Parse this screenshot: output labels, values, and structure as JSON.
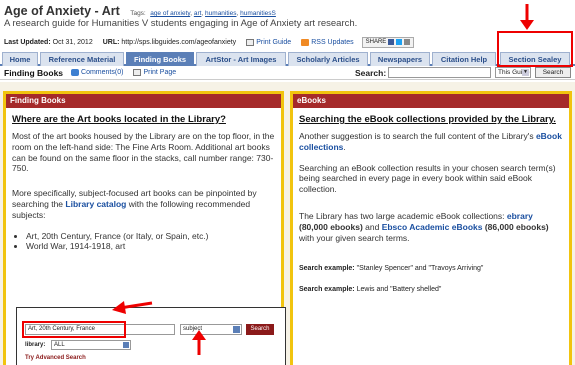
{
  "header": {
    "title": "Age of Anxiety - Art",
    "tags_label": "Tags:",
    "tags": [
      "age of anxiety",
      "art",
      "humanities",
      "humanitiesS"
    ],
    "subtitle": "A research guide for Humanities V students engaging in Age of Anxiety art research.",
    "last_updated_label": "Last Updated:",
    "last_updated": "Oct 31, 2012",
    "url_label": "URL:",
    "url": "http://sps.libguides.com/ageofanxiety",
    "print_guide": "Print Guide",
    "rss_updates": "RSS Updates",
    "share": "SHARE"
  },
  "tabs": [
    {
      "label": "Home",
      "active": false
    },
    {
      "label": "Reference Material",
      "active": false
    },
    {
      "label": "Finding Books",
      "active": true
    },
    {
      "label": "ArtStor - Art Images",
      "active": false
    },
    {
      "label": "Scholarly Articles",
      "active": false
    },
    {
      "label": "Newspapers",
      "active": false
    },
    {
      "label": "Citation Help",
      "active": false
    },
    {
      "label": "Section Sealey",
      "active": false
    }
  ],
  "subbar": {
    "page_name": "Finding Books",
    "comments": "Comments(0)",
    "print_page": "Print Page",
    "search_label": "Search:",
    "search_value": "",
    "scope": "This Guide",
    "search_button": "Search"
  },
  "left_box": {
    "header": "Finding Books",
    "question": "Where are the Art books located in the Library?",
    "para1": "Most of the art books housed by the Library are on the top floor, in the room on the left-hand side: The Fine Arts Room.  Additional art books can be found on the same floor in the stacks, call number range: 730-750.",
    "para2_pre": "More specifically, subject-focused art books can be pinpointed by searching the ",
    "para2_link": "Library catalog",
    "para2_post": " with the following recommended subjects:",
    "subjects": [
      "Art, 20th Century, France (or Italy, or Spain, etc.)",
      "World War, 1914-1918, art"
    ],
    "screenshot": {
      "input_value": "Art, 20th Century, France",
      "select_value": "subject",
      "button": "Search",
      "library_label": "library:",
      "library_value": "ALL",
      "advanced": "Try Advanced Search"
    }
  },
  "right_box": {
    "header": "eBooks",
    "question": "Searching the eBook collections provided by the Library.",
    "para1_pre": "Another suggestion is to search the full content of the Library's ",
    "para1_link": "eBook collections",
    "para1_post": ".",
    "para2": "Searching an eBook collection results in your chosen search term(s) being searched in every page in every book within said eBook collection.",
    "para3_pre": "The Library has two large academic eBook collections: ",
    "ebrary": "ebrary",
    "ebrary_count": "(80,000 ebooks)",
    "and": " and ",
    "ebsco": "Ebsco Academic eBooks",
    "ebsco_count": "(86,000 ebooks)",
    "para3_post": " with your given search terms.",
    "ex1_label": "Search example:",
    "ex1_value": " \"Stanley Spencer\" and \"Travoys Arriving\"",
    "ex2_label": "Search example:",
    "ex2_value": " Lewis and \"Battery shelled\""
  },
  "colors": {
    "tab_active": "#5b7fb7",
    "box_border": "#f1c40f",
    "box_header": "#a52a2a",
    "annotation": "#e00000",
    "link": "#1a4fa0"
  }
}
